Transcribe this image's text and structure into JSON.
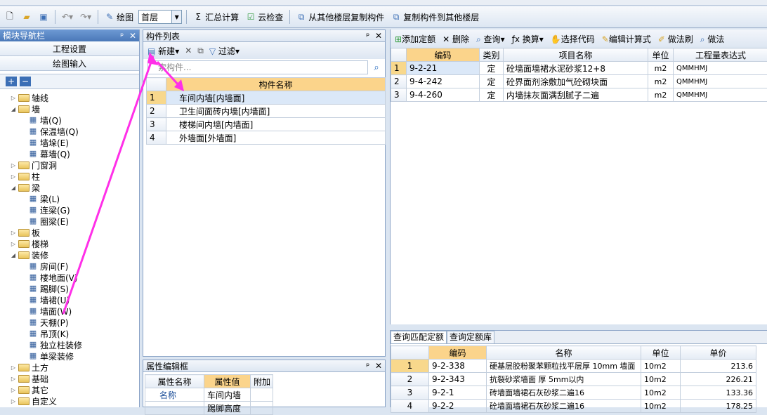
{
  "toolbar": {
    "draw_label": "绘图",
    "floor_value": "首层",
    "sum_label": "汇总计算",
    "cloud_check_label": "云检查",
    "copy_from_label": "从其他楼层复制构件",
    "copy_to_label": "复制构件到其他楼层"
  },
  "nav": {
    "title": "模块导航栏",
    "project_settings": "工程设置",
    "drawing_input": "绘图输入",
    "tree": [
      {
        "label": "轴线",
        "level": 0,
        "type": "folder",
        "toggle": "▷"
      },
      {
        "label": "墙",
        "level": 0,
        "type": "folder",
        "toggle": "◢"
      },
      {
        "label": "墙(Q)",
        "level": 1,
        "type": "leaf",
        "icon": "wall-icon"
      },
      {
        "label": "保温墙(Q)",
        "level": 1,
        "type": "leaf",
        "icon": "insulation-wall-icon"
      },
      {
        "label": "墙垛(E)",
        "level": 1,
        "type": "leaf",
        "icon": "wall-pier-icon"
      },
      {
        "label": "幕墙(Q)",
        "level": 1,
        "type": "leaf",
        "icon": "curtain-wall-icon"
      },
      {
        "label": "门窗洞",
        "level": 0,
        "type": "folder",
        "toggle": "▷"
      },
      {
        "label": "柱",
        "level": 0,
        "type": "folder",
        "toggle": "▷"
      },
      {
        "label": "梁",
        "level": 0,
        "type": "folder",
        "toggle": "◢"
      },
      {
        "label": "梁(L)",
        "level": 1,
        "type": "leaf",
        "icon": "beam-icon"
      },
      {
        "label": "连梁(G)",
        "level": 1,
        "type": "leaf",
        "icon": "coupling-beam-icon"
      },
      {
        "label": "圈梁(E)",
        "level": 1,
        "type": "leaf",
        "icon": "ring-beam-icon"
      },
      {
        "label": "板",
        "level": 0,
        "type": "folder",
        "toggle": "▷"
      },
      {
        "label": "楼梯",
        "level": 0,
        "type": "folder",
        "toggle": "▷"
      },
      {
        "label": "装修",
        "level": 0,
        "type": "folder",
        "toggle": "◢"
      },
      {
        "label": "房间(F)",
        "level": 1,
        "type": "leaf",
        "icon": "room-icon"
      },
      {
        "label": "楼地面(V)",
        "level": 1,
        "type": "leaf",
        "icon": "floor-icon"
      },
      {
        "label": "踢脚(S)",
        "level": 1,
        "type": "leaf",
        "icon": "skirting-icon"
      },
      {
        "label": "墙裙(U)",
        "level": 1,
        "type": "leaf",
        "icon": "dado-icon"
      },
      {
        "label": "墙面(W)",
        "level": 1,
        "type": "leaf",
        "icon": "wall-surface-icon"
      },
      {
        "label": "天棚(P)",
        "level": 1,
        "type": "leaf",
        "icon": "ceiling-icon"
      },
      {
        "label": "吊顶(K)",
        "level": 1,
        "type": "leaf",
        "icon": "suspended-ceiling-icon"
      },
      {
        "label": "独立柱装修",
        "level": 1,
        "type": "leaf",
        "icon": "column-finish-icon"
      },
      {
        "label": "单梁装修",
        "level": 1,
        "type": "leaf",
        "icon": "beam-finish-icon"
      },
      {
        "label": "土方",
        "level": 0,
        "type": "folder",
        "toggle": "▷"
      },
      {
        "label": "基础",
        "level": 0,
        "type": "folder",
        "toggle": "▷"
      },
      {
        "label": "其它",
        "level": 0,
        "type": "folder",
        "toggle": "▷"
      },
      {
        "label": "自定义",
        "level": 0,
        "type": "folder",
        "toggle": "▷"
      }
    ]
  },
  "component_list": {
    "title": "构件列表",
    "new_label": "新建",
    "filter_label": "过滤",
    "search_placeholder": "索构件...",
    "column_header": "构件名称",
    "rows": [
      {
        "num": "1",
        "name": "车间内墙[内墙面]"
      },
      {
        "num": "2",
        "name": "卫生间面砖内墙[内墙面]"
      },
      {
        "num": "3",
        "name": "楼梯间内墙[内墙面]"
      },
      {
        "num": "4",
        "name": "外墙面[外墙面]"
      }
    ]
  },
  "property_editor": {
    "title": "属性编辑框",
    "col_name": "属性名称",
    "col_value": "属性值",
    "col_extra": "附加",
    "rows": [
      {
        "name": "名称",
        "value": "车间内墙"
      },
      {
        "name": "",
        "value": "踢脚高度"
      }
    ]
  },
  "quota": {
    "toolbar": {
      "add_quota": "添加定额",
      "delete": "删除",
      "query": "查询",
      "convert": "换算",
      "select_code": "选择代码",
      "edit_formula": "编辑计算式",
      "method_brush": "做法刷",
      "method_query": "做法"
    },
    "headers": [
      "编码",
      "类别",
      "项目名称",
      "单位",
      "工程量表达式"
    ],
    "rows": [
      {
        "num": "1",
        "code": "9-2-21",
        "type": "定",
        "name": "砼墙面墙裙水泥砂浆12+8",
        "unit": "m2",
        "expr": "QMMHMJ"
      },
      {
        "num": "2",
        "code": "9-4-242",
        "type": "定",
        "name": "砼界面剂涂敷加气砼砌块面",
        "unit": "m2",
        "expr": "QMMHMJ"
      },
      {
        "num": "3",
        "code": "9-4-260",
        "type": "定",
        "name": "内墙抹灰面满刮腻子二遍",
        "unit": "m2",
        "expr": "QMMHMJ"
      }
    ]
  },
  "match": {
    "tab_match": "查询匹配定额",
    "tab_library": "查询定额库",
    "headers": [
      "编码",
      "名称",
      "单位",
      "单价"
    ],
    "rows": [
      {
        "num": "1",
        "code": "9-2-338",
        "name": "硬基层胶粉聚苯颗粒找平层厚 10mm 墙面",
        "unit": "10m2",
        "price": "213.6"
      },
      {
        "num": "2",
        "code": "9-2-343",
        "name": "抗裂砂浆墙面 厚 5mm以内",
        "unit": "10m2",
        "price": "226.21"
      },
      {
        "num": "3",
        "code": "9-2-1",
        "name": "砖墙面墙裙石灰砂浆二遍16",
        "unit": "10m2",
        "price": "133.36"
      },
      {
        "num": "4",
        "code": "9-2-2",
        "name": "砼墙面墙裙石灰砂浆二遍16",
        "unit": "10m2",
        "price": "178.25"
      }
    ]
  },
  "colors": {
    "accent": "#2d6fc0",
    "highlight": "#fbd48b",
    "arrow": "#ff2fe8"
  }
}
